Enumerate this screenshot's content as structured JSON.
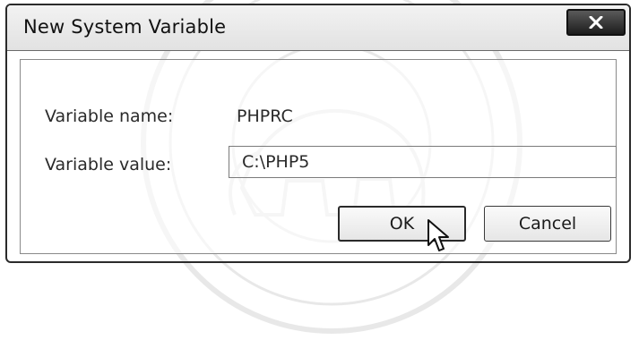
{
  "dialog": {
    "title": "New System Variable",
    "close_label": "x"
  },
  "fields": {
    "name_label": "Variable name:",
    "name_value": "PHPRC",
    "value_label": "Variable value:",
    "value_value": "C:\\PHP5"
  },
  "buttons": {
    "ok_label": "OK",
    "cancel_label": "Cancel"
  },
  "icons": {
    "close": "close-icon",
    "cursor": "mouse-pointer-icon"
  }
}
